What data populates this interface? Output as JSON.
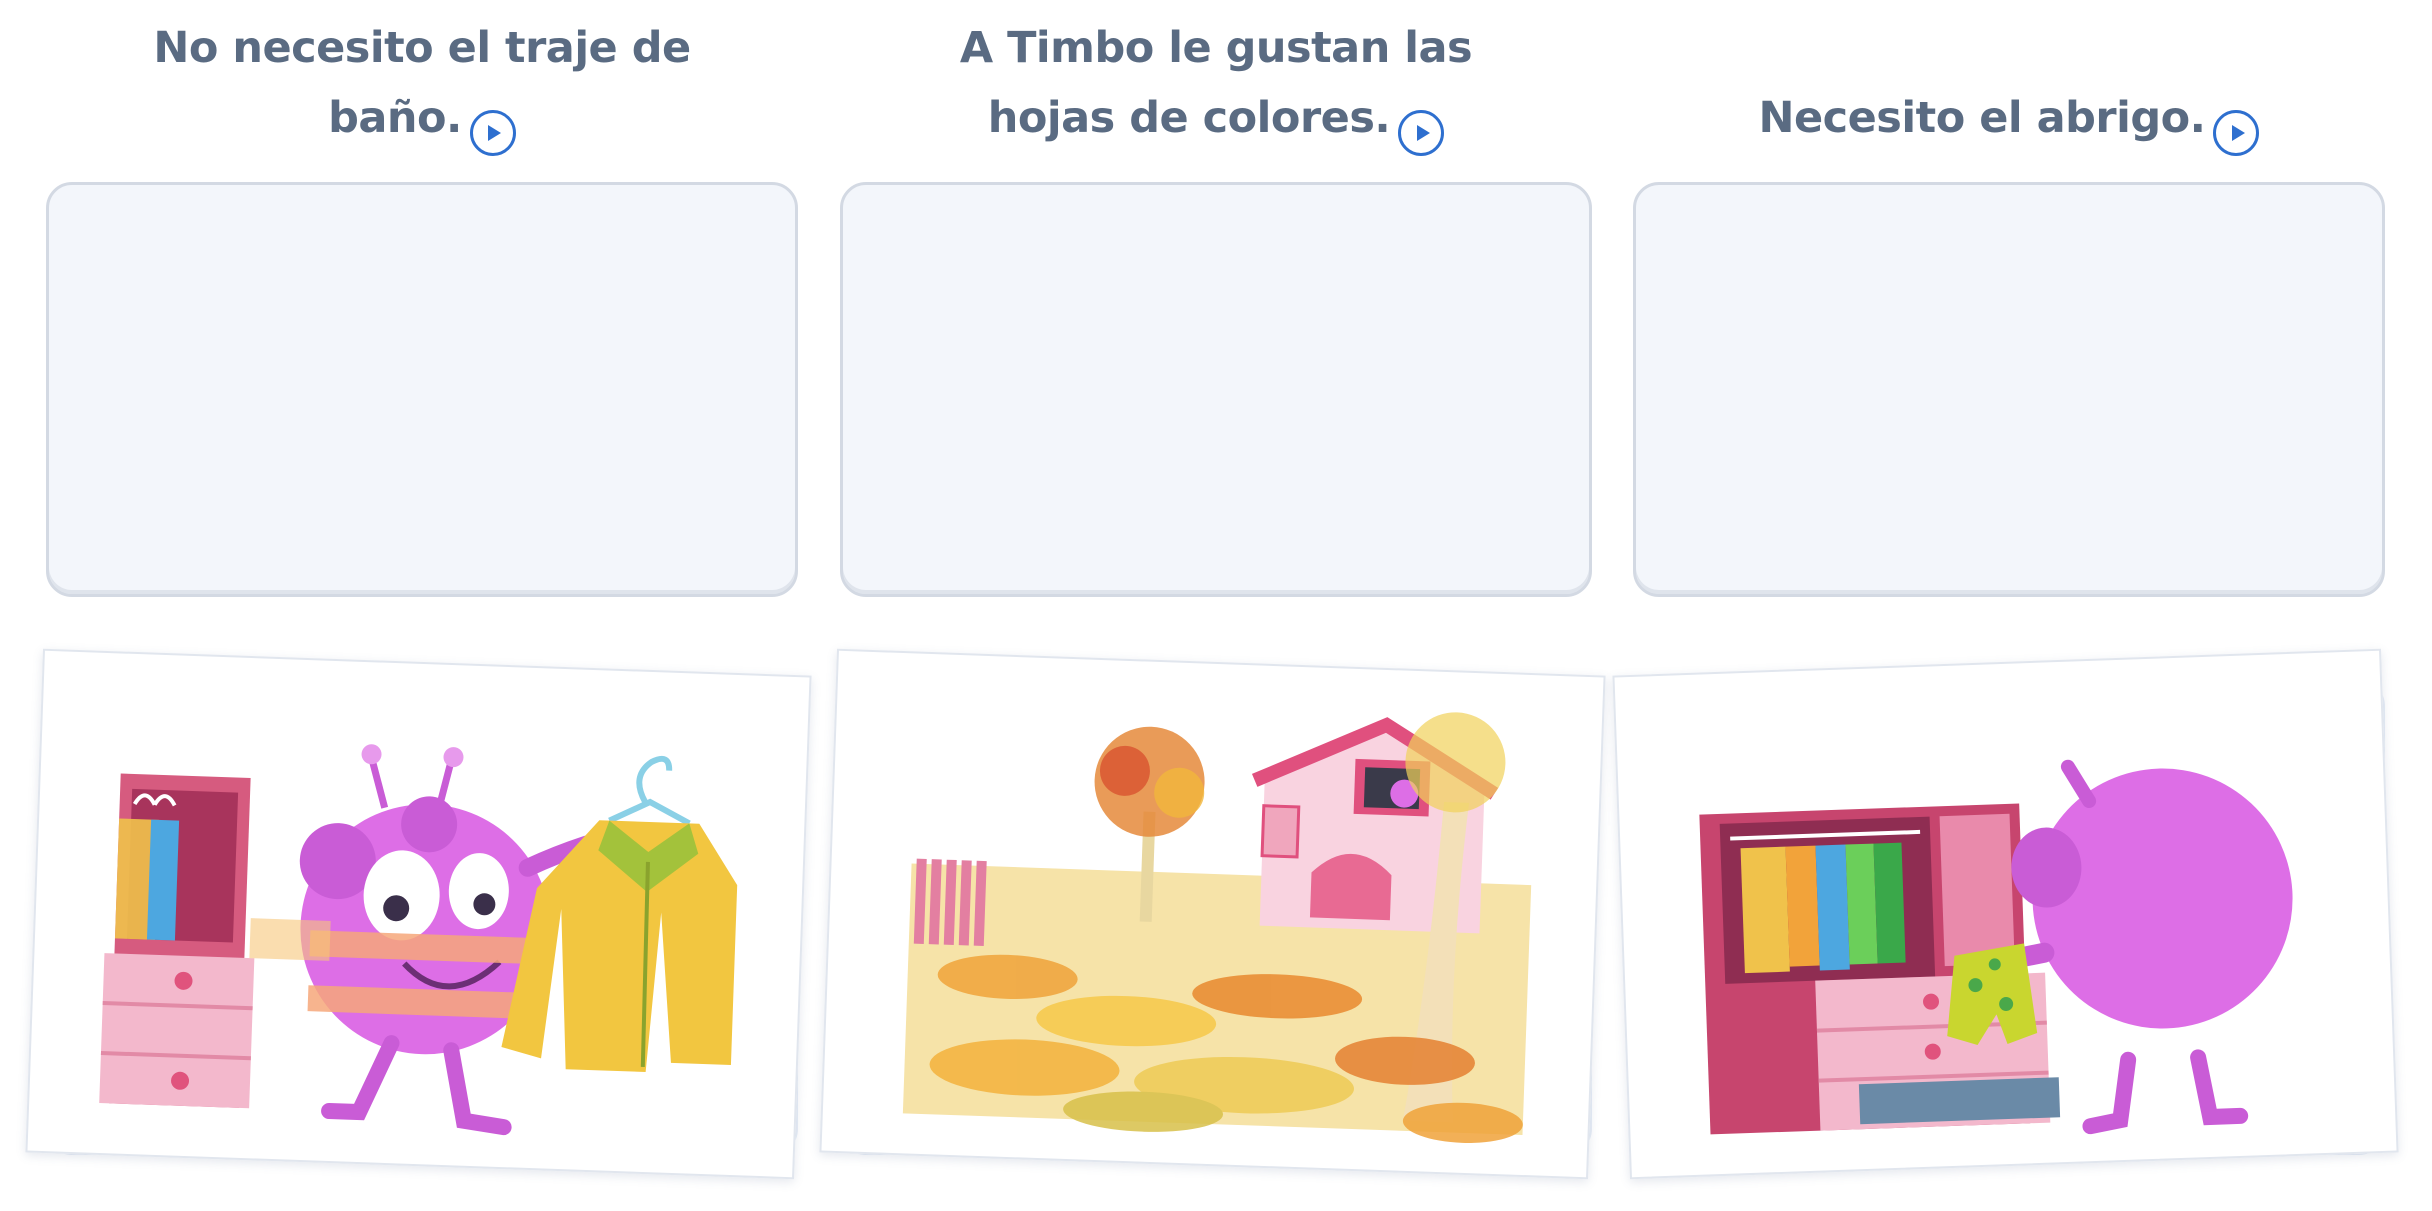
{
  "cards": [
    {
      "caption": "No necesito el traje de baño.",
      "illustration": "monster-holding-yellow-coat"
    },
    {
      "caption": "A Timbo le gustan las hojas de colores.",
      "illustration": "house-with-autumn-leaves"
    },
    {
      "caption": "Necesito el abrigo.",
      "illustration": "monster-at-dresser"
    }
  ],
  "icons": {
    "audio": "play-audio-icon"
  },
  "colors": {
    "caption_text": "#5a6b82",
    "accent": "#2e6fcf",
    "dropzone_bg": "#f3f6fb",
    "monster": "#dd6ee6"
  }
}
